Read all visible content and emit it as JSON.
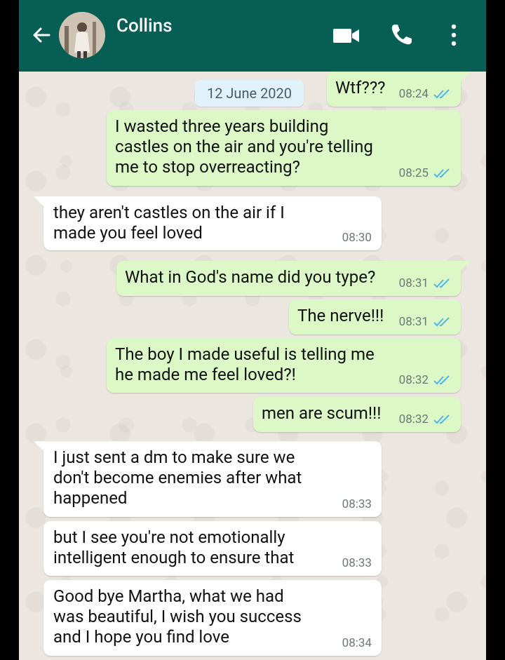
{
  "header": {
    "contact_name": "Collins",
    "icons": [
      "back-arrow-icon",
      "video-call-icon",
      "voice-call-icon",
      "more-options-icon"
    ]
  },
  "date_chip": "12 June 2020",
  "messages": [
    {
      "direction": "out",
      "text": "Wtf???",
      "time": "08:24",
      "status": "read"
    },
    {
      "direction": "out",
      "text": "I wasted three years building\ncastles on the air and you're telling\nme to stop overreacting?",
      "time": "08:25",
      "status": "read"
    },
    {
      "direction": "in",
      "text": "they aren't castles on the air if I\nmade you feel loved",
      "time": "08:30"
    },
    {
      "direction": "out",
      "text": "What in God's name did you type?",
      "time": "08:31",
      "status": "read"
    },
    {
      "direction": "out",
      "text": "The nerve!!!",
      "time": "08:31",
      "status": "read"
    },
    {
      "direction": "out",
      "text": "The boy I made useful is telling me\nhe made me feel loved?!",
      "time": "08:32",
      "status": "read"
    },
    {
      "direction": "out",
      "text": "men are scum!!!",
      "time": "08:32",
      "status": "read"
    },
    {
      "direction": "in",
      "text": "I just sent a dm to make sure we\ndon't become enemies after what\nhappened",
      "time": "08:33"
    },
    {
      "direction": "in",
      "text": "but I see you're not emotionally\nintelligent enough to ensure that",
      "time": "08:33"
    },
    {
      "direction": "in",
      "text": "Good bye Martha, what we had\nwas beautiful, I wish you success\nand I hope you find love",
      "time": "08:34"
    }
  ],
  "colors": {
    "header": "#075e54",
    "outgoing_bubble": "#dcf8c6",
    "incoming_bubble": "#ffffff",
    "read_ticks": "#4fb6ec",
    "chat_background": "#ece5dd"
  }
}
